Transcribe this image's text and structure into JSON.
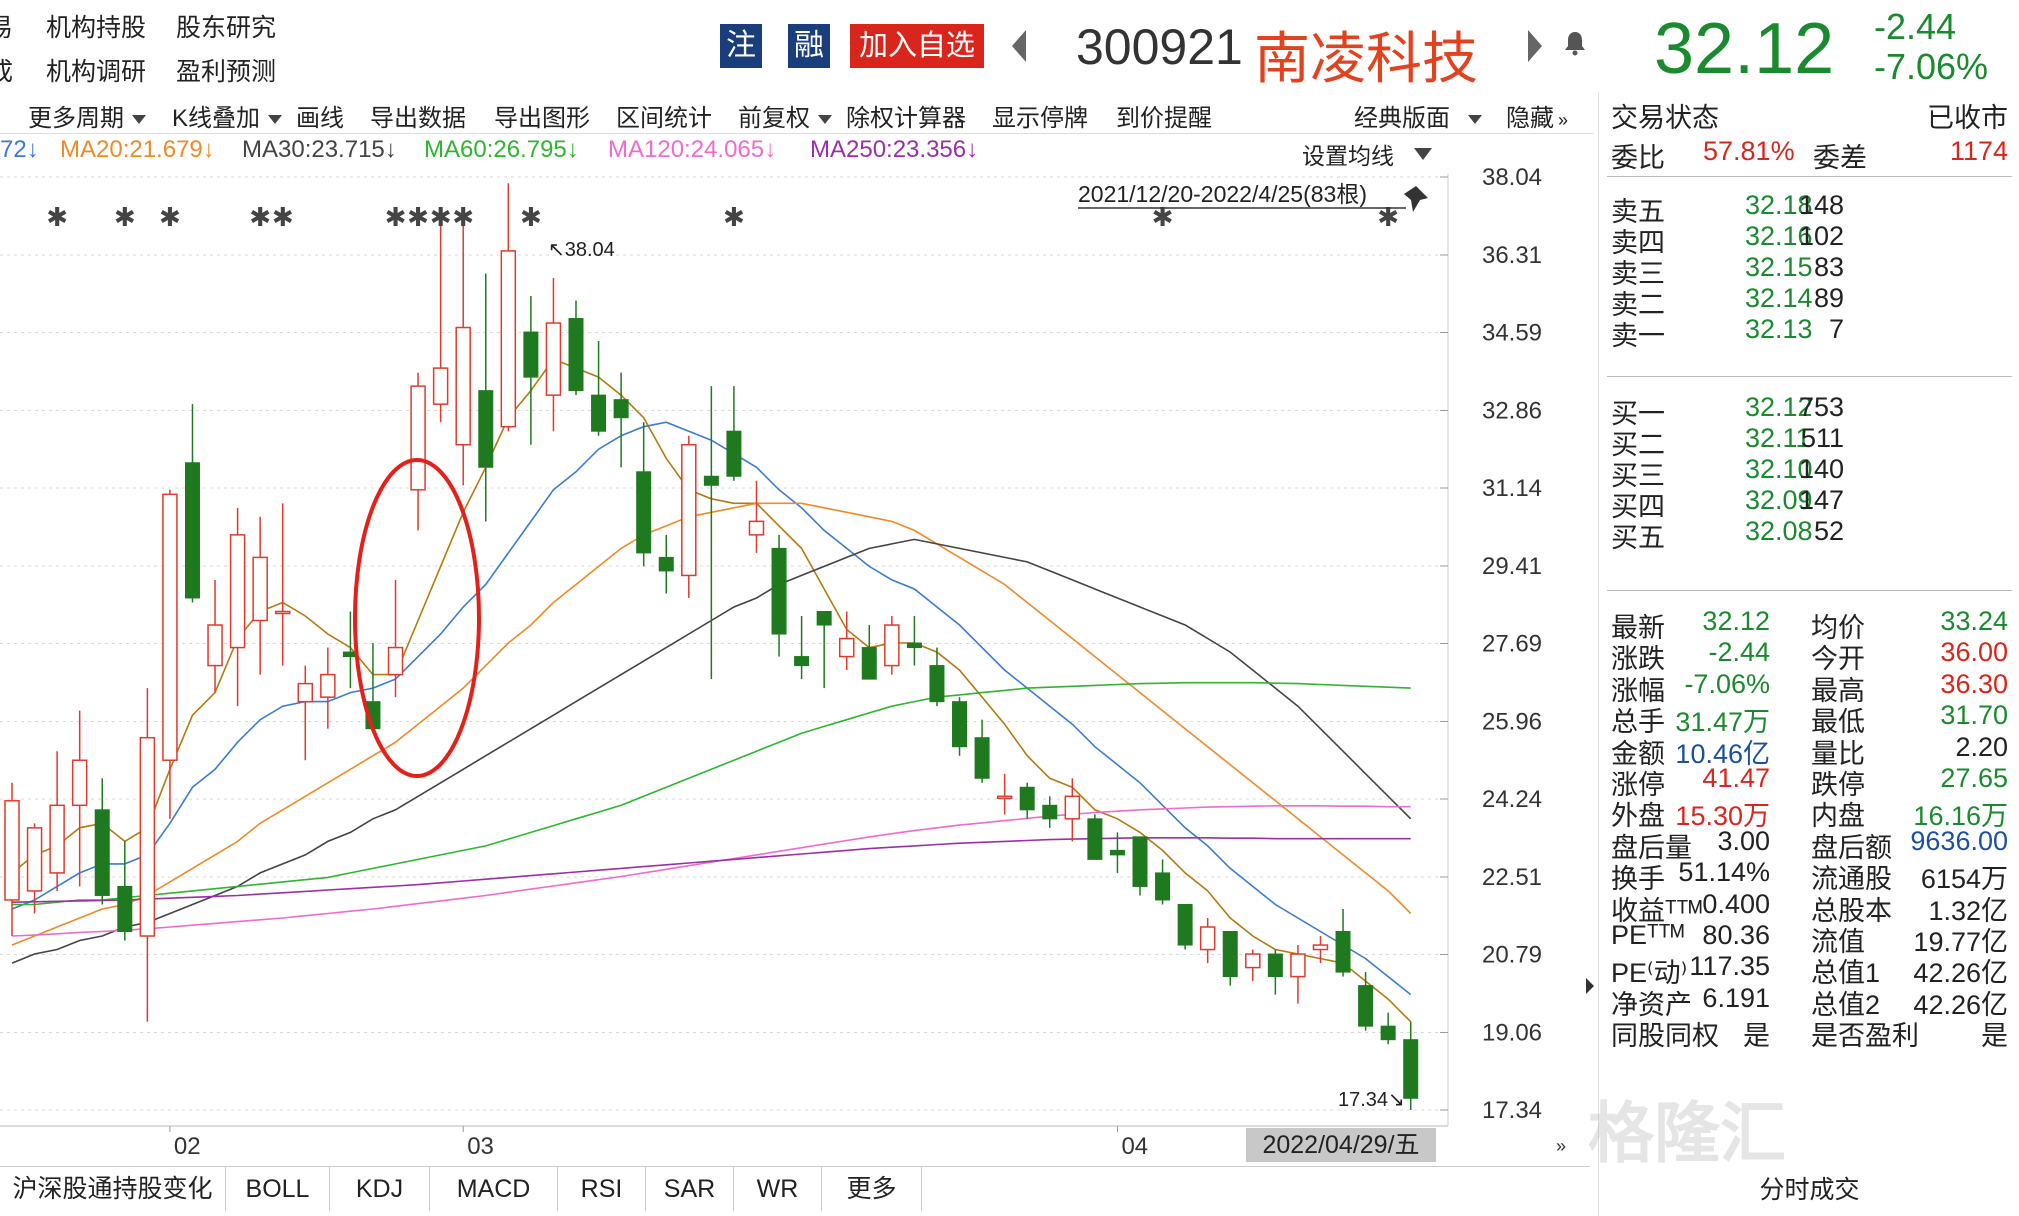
{
  "header": {
    "nav_row1": [
      "易",
      "机构持股",
      "股东研究"
    ],
    "nav_row2": [
      "成",
      "机构调研",
      "盈利预测"
    ],
    "badge_zhu": "注",
    "badge_rong": "融",
    "add_watchlist": "加入自选",
    "stock_code": "300921",
    "stock_name": "南凌科技",
    "last_price": "32.12",
    "change_abs": "-2.44",
    "change_pct": "-7.06%"
  },
  "toolbar": {
    "more_period": "更多周期",
    "kline_overlay": "K线叠加",
    "draw_line": "画线",
    "export_data": "导出数据",
    "export_chart": "导出图形",
    "range_stats": "区间统计",
    "pre_adjust": "前复权",
    "ex_right_calc": "除权计算器",
    "show_suspend": "显示停牌",
    "price_alert": "到价提醒",
    "classic_layout": "经典版面",
    "hide": "隐藏"
  },
  "ma_legend": [
    {
      "text": "72↓",
      "color": "#3a7bd5"
    },
    {
      "text": "MA20:21.679↓",
      "color": "#f08a24"
    },
    {
      "text": "MA30:23.715↓",
      "color": "#444444"
    },
    {
      "text": "MA60:26.795↓",
      "color": "#2fb52f"
    },
    {
      "text": "MA120:24.065↓",
      "color": "#f06ad0"
    },
    {
      "text": "MA250:23.356↓",
      "color": "#9b2fa8"
    }
  ],
  "chart_overlay": {
    "set_ma": "设置均线",
    "date_range": "2021/12/20-2022/4/25(83根)",
    "high_label": "↖38.04",
    "low_label": "17.34↘",
    "cursor_date": "2022/04/29/五"
  },
  "chart_data": {
    "type": "candlestick",
    "y_ticks": [
      38.04,
      36.31,
      34.59,
      32.86,
      31.14,
      29.41,
      27.69,
      25.96,
      24.24,
      22.51,
      20.79,
      19.06,
      17.34
    ],
    "x_ticks": [
      "02",
      "03",
      "04"
    ],
    "ylim": [
      17.34,
      38.04
    ],
    "up_color": "#e03a2e",
    "down_color": "#1f7a1f",
    "candles": [
      {
        "o": 22.0,
        "h": 24.6,
        "l": 21.2,
        "c": 24.2
      },
      {
        "o": 22.2,
        "h": 23.7,
        "l": 21.7,
        "c": 23.6
      },
      {
        "o": 22.6,
        "h": 25.3,
        "l": 22.2,
        "c": 24.1
      },
      {
        "o": 24.1,
        "h": 26.2,
        "l": 22.3,
        "c": 25.1
      },
      {
        "o": 24.0,
        "h": 24.7,
        "l": 21.9,
        "c": 22.1
      },
      {
        "o": 22.3,
        "h": 23.3,
        "l": 21.1,
        "c": 21.3
      },
      {
        "o": 21.2,
        "h": 26.7,
        "l": 19.3,
        "c": 25.6
      },
      {
        "o": 25.1,
        "h": 31.1,
        "l": 23.8,
        "c": 31.0
      },
      {
        "o": 31.7,
        "h": 33.0,
        "l": 28.6,
        "c": 28.7
      },
      {
        "o": 27.2,
        "h": 29.1,
        "l": 26.6,
        "c": 28.1
      },
      {
        "o": 27.6,
        "h": 30.7,
        "l": 26.3,
        "c": 30.1
      },
      {
        "o": 28.2,
        "h": 30.5,
        "l": 27.0,
        "c": 29.6
      },
      {
        "o": 28.4,
        "h": 30.8,
        "l": 27.2,
        "c": 28.4
      },
      {
        "o": 26.4,
        "h": 27.2,
        "l": 25.1,
        "c": 26.8
      },
      {
        "o": 26.5,
        "h": 27.6,
        "l": 25.8,
        "c": 27.0
      },
      {
        "o": 27.5,
        "h": 28.4,
        "l": 26.7,
        "c": 27.4
      },
      {
        "o": 26.4,
        "h": 27.7,
        "l": 25.7,
        "c": 25.8
      },
      {
        "o": 27.0,
        "h": 29.1,
        "l": 26.5,
        "c": 27.6
      },
      {
        "o": 31.1,
        "h": 33.7,
        "l": 30.2,
        "c": 33.4
      },
      {
        "o": 33.0,
        "h": 37.3,
        "l": 32.6,
        "c": 33.8
      },
      {
        "o": 32.1,
        "h": 37.2,
        "l": 31.2,
        "c": 34.7
      },
      {
        "o": 33.3,
        "h": 35.9,
        "l": 30.4,
        "c": 31.6
      },
      {
        "o": 32.5,
        "h": 37.9,
        "l": 32.4,
        "c": 36.4
      },
      {
        "o": 34.6,
        "h": 35.4,
        "l": 32.1,
        "c": 33.6
      },
      {
        "o": 33.2,
        "h": 35.8,
        "l": 32.4,
        "c": 34.8
      },
      {
        "o": 34.9,
        "h": 35.3,
        "l": 33.2,
        "c": 33.3
      },
      {
        "o": 33.2,
        "h": 34.4,
        "l": 32.3,
        "c": 32.4
      },
      {
        "o": 33.1,
        "h": 33.7,
        "l": 31.6,
        "c": 32.7
      },
      {
        "o": 31.5,
        "h": 32.6,
        "l": 29.4,
        "c": 29.7
      },
      {
        "o": 29.6,
        "h": 30.1,
        "l": 28.8,
        "c": 29.3
      },
      {
        "o": 29.2,
        "h": 32.3,
        "l": 28.7,
        "c": 32.1
      },
      {
        "o": 31.4,
        "h": 33.4,
        "l": 26.9,
        "c": 31.2
      },
      {
        "o": 32.4,
        "h": 33.4,
        "l": 31.3,
        "c": 31.4
      },
      {
        "o": 30.1,
        "h": 31.3,
        "l": 29.7,
        "c": 30.4
      },
      {
        "o": 29.8,
        "h": 30.1,
        "l": 27.4,
        "c": 27.9
      },
      {
        "o": 27.4,
        "h": 28.3,
        "l": 26.9,
        "c": 27.2
      },
      {
        "o": 28.4,
        "h": 28.4,
        "l": 26.7,
        "c": 28.1
      },
      {
        "o": 27.4,
        "h": 28.4,
        "l": 27.1,
        "c": 27.8
      },
      {
        "o": 27.6,
        "h": 28.1,
        "l": 26.9,
        "c": 26.9
      },
      {
        "o": 27.2,
        "h": 28.3,
        "l": 27.0,
        "c": 28.1
      },
      {
        "o": 27.7,
        "h": 28.3,
        "l": 27.2,
        "c": 27.6
      },
      {
        "o": 27.2,
        "h": 27.6,
        "l": 26.3,
        "c": 26.4
      },
      {
        "o": 26.4,
        "h": 26.5,
        "l": 25.2,
        "c": 25.4
      },
      {
        "o": 25.6,
        "h": 26.0,
        "l": 24.6,
        "c": 24.7
      },
      {
        "o": 24.3,
        "h": 24.8,
        "l": 23.9,
        "c": 24.3
      },
      {
        "o": 24.5,
        "h": 24.6,
        "l": 23.8,
        "c": 24.0
      },
      {
        "o": 24.1,
        "h": 24.3,
        "l": 23.6,
        "c": 23.8
      },
      {
        "o": 23.8,
        "h": 24.7,
        "l": 23.3,
        "c": 24.3
      },
      {
        "o": 23.8,
        "h": 23.9,
        "l": 22.9,
        "c": 22.9
      },
      {
        "o": 23.1,
        "h": 23.5,
        "l": 22.6,
        "c": 23.0
      },
      {
        "o": 23.4,
        "h": 23.4,
        "l": 22.1,
        "c": 22.3
      },
      {
        "o": 22.6,
        "h": 22.9,
        "l": 21.9,
        "c": 22.0
      },
      {
        "o": 21.9,
        "h": 21.9,
        "l": 20.9,
        "c": 21.0
      },
      {
        "o": 20.9,
        "h": 21.6,
        "l": 20.6,
        "c": 21.4
      },
      {
        "o": 21.3,
        "h": 21.3,
        "l": 20.1,
        "c": 20.3
      },
      {
        "o": 20.5,
        "h": 20.9,
        "l": 20.2,
        "c": 20.8
      },
      {
        "o": 20.8,
        "h": 20.9,
        "l": 19.9,
        "c": 20.3
      },
      {
        "o": 20.3,
        "h": 21.0,
        "l": 19.7,
        "c": 20.8
      },
      {
        "o": 20.9,
        "h": 21.2,
        "l": 20.6,
        "c": 21.0
      },
      {
        "o": 21.3,
        "h": 21.8,
        "l": 20.3,
        "c": 20.4
      },
      {
        "o": 20.1,
        "h": 20.4,
        "l": 19.1,
        "c": 19.2
      },
      {
        "o": 19.2,
        "h": 19.5,
        "l": 18.8,
        "c": 18.9
      },
      {
        "o": 18.9,
        "h": 19.3,
        "l": 17.34,
        "c": 17.6
      }
    ],
    "ma_lines": {
      "MA5": {
        "color": "#b5790f",
        "values": [
          22.6,
          23.0,
          23.2,
          23.6,
          23.7,
          23.3,
          23.6,
          24.9,
          26.1,
          26.6,
          27.8,
          28.4,
          28.6,
          28.3,
          27.9,
          27.6,
          27.0,
          27.0,
          28.2,
          29.4,
          30.6,
          31.6,
          32.7,
          33.3,
          34.0,
          33.8,
          33.6,
          33.2,
          32.7,
          31.8,
          31.1,
          30.9,
          30.8,
          30.8,
          30.3,
          29.8,
          28.9,
          28.0,
          27.6,
          27.7,
          27.7,
          27.5,
          27.1,
          26.5,
          25.9,
          25.2,
          24.7,
          24.5,
          24.0,
          23.8,
          23.5,
          23.1,
          22.6,
          22.2,
          21.6,
          21.2,
          20.9,
          20.8,
          20.7,
          20.6,
          20.2,
          19.8,
          19.3
        ]
      },
      "MA10": {
        "color": "#3a7bd5",
        "values": [
          21.8,
          22.0,
          22.3,
          22.6,
          22.8,
          22.8,
          23.0,
          23.7,
          24.5,
          24.9,
          25.5,
          26.0,
          26.3,
          26.4,
          26.4,
          26.6,
          26.7,
          26.9,
          27.4,
          27.9,
          28.5,
          29.0,
          29.7,
          30.4,
          31.1,
          31.5,
          32.0,
          32.3,
          32.5,
          32.6,
          32.4,
          32.2,
          31.9,
          31.6,
          31.1,
          30.7,
          30.2,
          29.8,
          29.4,
          29.1,
          28.9,
          28.5,
          28.1,
          27.6,
          27.1,
          26.7,
          26.3,
          25.9,
          25.4,
          25.0,
          24.6,
          24.1,
          23.6,
          23.2,
          22.7,
          22.3,
          21.9,
          21.6,
          21.3,
          21.0,
          20.7,
          20.3,
          19.9
        ]
      },
      "MA20": {
        "color": "#f08a24",
        "values": [
          21.0,
          21.2,
          21.4,
          21.6,
          21.8,
          21.9,
          22.1,
          22.4,
          22.7,
          23.0,
          23.3,
          23.7,
          24.0,
          24.3,
          24.6,
          24.9,
          25.2,
          25.5,
          25.9,
          26.3,
          26.7,
          27.2,
          27.7,
          28.1,
          28.6,
          29.0,
          29.4,
          29.8,
          30.1,
          30.3,
          30.5,
          30.6,
          30.7,
          30.8,
          30.8,
          30.8,
          30.7,
          30.6,
          30.5,
          30.4,
          30.2,
          29.9,
          29.6,
          29.3,
          29.0,
          28.6,
          28.2,
          27.8,
          27.4,
          27.0,
          26.6,
          26.2,
          25.8,
          25.4,
          25.0,
          24.6,
          24.2,
          23.8,
          23.4,
          23.0,
          22.6,
          22.2,
          21.7
        ]
      },
      "MA30": {
        "color": "#444444",
        "values": [
          20.6,
          20.8,
          20.9,
          21.1,
          21.2,
          21.4,
          21.5,
          21.7,
          21.9,
          22.1,
          22.3,
          22.6,
          22.8,
          23.0,
          23.3,
          23.5,
          23.8,
          24.0,
          24.3,
          24.6,
          24.9,
          25.2,
          25.5,
          25.8,
          26.1,
          26.4,
          26.7,
          27.0,
          27.3,
          27.6,
          27.9,
          28.2,
          28.5,
          28.7,
          29.0,
          29.2,
          29.4,
          29.6,
          29.8,
          29.9,
          30.0,
          29.9,
          29.8,
          29.7,
          29.6,
          29.5,
          29.3,
          29.1,
          28.9,
          28.7,
          28.5,
          28.3,
          28.1,
          27.8,
          27.5,
          27.1,
          26.7,
          26.3,
          25.8,
          25.3,
          24.8,
          24.3,
          23.8
        ]
      },
      "MA60": {
        "color": "#2fb52f",
        "values": [
          21.9,
          21.9,
          21.95,
          22.0,
          22.0,
          22.05,
          22.1,
          22.15,
          22.2,
          22.25,
          22.3,
          22.35,
          22.4,
          22.45,
          22.5,
          22.6,
          22.7,
          22.8,
          22.9,
          23.0,
          23.1,
          23.2,
          23.35,
          23.5,
          23.65,
          23.8,
          23.95,
          24.1,
          24.3,
          24.5,
          24.7,
          24.9,
          25.1,
          25.3,
          25.5,
          25.7,
          25.85,
          26.0,
          26.15,
          26.3,
          26.4,
          26.5,
          26.55,
          26.6,
          26.65,
          26.7,
          26.72,
          26.74,
          26.76,
          26.78,
          26.8,
          26.81,
          26.82,
          26.82,
          26.82,
          26.82,
          26.81,
          26.8,
          26.78,
          26.76,
          26.74,
          26.72,
          26.7
        ]
      },
      "MA120": {
        "color": "#f06ad0",
        "values": [
          21.2,
          21.22,
          21.25,
          21.28,
          21.3,
          21.33,
          21.36,
          21.4,
          21.44,
          21.48,
          21.52,
          21.56,
          21.6,
          21.65,
          21.7,
          21.75,
          21.8,
          21.86,
          21.92,
          21.98,
          22.04,
          22.1,
          22.17,
          22.24,
          22.31,
          22.38,
          22.45,
          22.52,
          22.6,
          22.68,
          22.76,
          22.84,
          22.92,
          23.0,
          23.08,
          23.16,
          23.24,
          23.32,
          23.4,
          23.47,
          23.54,
          23.6,
          23.66,
          23.71,
          23.76,
          23.81,
          23.86,
          23.9,
          23.94,
          23.97,
          24.0,
          24.02,
          24.04,
          24.06,
          24.07,
          24.08,
          24.09,
          24.09,
          24.09,
          24.08,
          24.08,
          24.07,
          24.07
        ]
      },
      "MA250": {
        "color": "#9b2fa8",
        "values": [
          21.95,
          21.96,
          21.97,
          21.98,
          21.99,
          22.0,
          22.02,
          22.04,
          22.06,
          22.08,
          22.1,
          22.13,
          22.16,
          22.19,
          22.22,
          22.25,
          22.28,
          22.31,
          22.34,
          22.38,
          22.42,
          22.46,
          22.5,
          22.54,
          22.58,
          22.62,
          22.66,
          22.7,
          22.74,
          22.78,
          22.82,
          22.86,
          22.9,
          22.94,
          22.98,
          23.02,
          23.06,
          23.1,
          23.14,
          23.17,
          23.2,
          23.23,
          23.26,
          23.28,
          23.3,
          23.32,
          23.34,
          23.35,
          23.36,
          23.37,
          23.38,
          23.38,
          23.38,
          23.38,
          23.37,
          23.37,
          23.36,
          23.36,
          23.36,
          23.36,
          23.36,
          23.36,
          23.36
        ]
      }
    }
  },
  "right_panel": {
    "trade_status_label": "交易状态",
    "trade_status_value": "已收市",
    "wei_bi_label": "委比",
    "wei_bi_value": "57.81%",
    "wei_cha_label": "委差",
    "wei_cha_value": "1174",
    "asks": [
      {
        "label": "卖五",
        "price": "32.18",
        "vol": "148"
      },
      {
        "label": "卖四",
        "price": "32.16",
        "vol": "102"
      },
      {
        "label": "卖三",
        "price": "32.15",
        "vol": "83"
      },
      {
        "label": "卖二",
        "price": "32.14",
        "vol": "89"
      },
      {
        "label": "卖一",
        "price": "32.13",
        "vol": "7"
      }
    ],
    "bids": [
      {
        "label": "买一",
        "price": "32.12",
        "vol": "753"
      },
      {
        "label": "买二",
        "price": "32.11",
        "vol": "511"
      },
      {
        "label": "买三",
        "price": "32.10",
        "vol": "140"
      },
      {
        "label": "买四",
        "price": "32.09",
        "vol": "147"
      },
      {
        "label": "买五",
        "price": "32.08",
        "vol": "52"
      }
    ],
    "stats": [
      {
        "l1": "最新",
        "v1": "32.12",
        "c1": "green",
        "l2": "均价",
        "v2": "33.24",
        "c2": "green"
      },
      {
        "l1": "涨跌",
        "v1": "-2.44",
        "c1": "green",
        "l2": "今开",
        "v2": "36.00",
        "c2": "red"
      },
      {
        "l1": "涨幅",
        "v1": "-7.06%",
        "c1": "green",
        "l2": "最高",
        "v2": "36.30",
        "c2": "red"
      },
      {
        "l1": "总手",
        "v1": "31.47万",
        "c1": "green",
        "l2": "最低",
        "v2": "31.70",
        "c2": "green"
      },
      {
        "l1": "金额",
        "v1": "10.46亿",
        "c1": "blue",
        "l2": "量比",
        "v2": "2.20",
        "c2": "dark"
      },
      {
        "l1": "涨停",
        "v1": "41.47",
        "c1": "red",
        "l2": "跌停",
        "v2": "27.65",
        "c2": "green"
      },
      {
        "l1": "外盘",
        "v1": "15.30万",
        "c1": "red",
        "l2": "内盘",
        "v2": "16.16万",
        "c2": "green"
      },
      {
        "l1": "盘后量",
        "v1": "3.00",
        "c1": "dark",
        "l2": "盘后额",
        "v2": "9636.00",
        "c2": "blue"
      },
      {
        "l1": "换手",
        "v1": "51.14%",
        "c1": "dark",
        "l2": "流通股",
        "v2": "6154万",
        "c2": "dark"
      },
      {
        "l1": "收益ᵀᵀᴹ",
        "v1": "0.400",
        "c1": "dark",
        "l2": "总股本",
        "v2": "1.32亿",
        "c2": "dark"
      },
      {
        "l1": "PEᵀᵀᴹ",
        "v1": "80.36",
        "c1": "dark",
        "l2": "流值",
        "v2": "19.77亿",
        "c2": "dark"
      },
      {
        "l1": "PE⁽动⁾",
        "v1": "117.35",
        "c1": "dark",
        "l2": "总值1",
        "v2": "42.26亿",
        "c2": "dark"
      },
      {
        "l1": "净资产",
        "v1": "6.191",
        "c1": "dark",
        "l2": "总值2",
        "v2": "42.26亿",
        "c2": "dark"
      },
      {
        "l1": "同股同权",
        "v1": "是",
        "c1": "dark",
        "l2": "是否盈利",
        "v2": "是",
        "c2": "dark"
      }
    ],
    "tick_trades_tab": "分时成交"
  },
  "bottom_tabs": [
    "沪深股通持股变化",
    "BOLL",
    "KDJ",
    "MACD",
    "RSI",
    "SAR",
    "WR",
    "更多"
  ],
  "watermark": "格隆汇"
}
